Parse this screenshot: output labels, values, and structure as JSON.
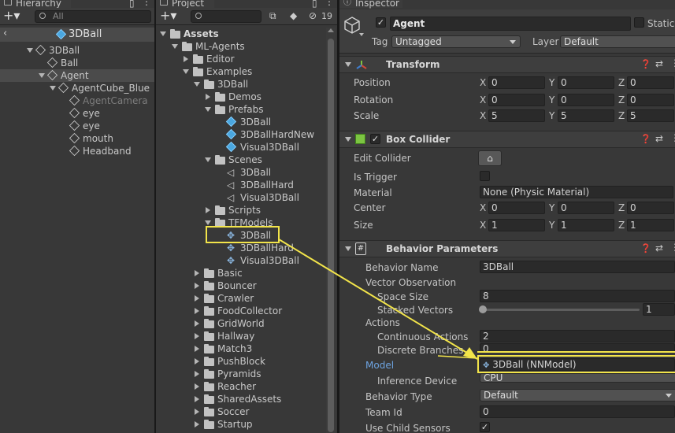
{
  "hierarchy": {
    "tab_title": "Hierarchy",
    "search_placeholder": "All",
    "scene_name": "3DBall",
    "items": [
      {
        "label": "3DBall",
        "depth": 0,
        "expanded": true
      },
      {
        "label": "Ball",
        "depth": 1
      },
      {
        "label": "Agent",
        "depth": 1,
        "expanded": true,
        "selected": true
      },
      {
        "label": "AgentCube_Blue",
        "depth": 2,
        "expanded": true
      },
      {
        "label": "AgentCamera",
        "depth": 3,
        "dimmed": true
      },
      {
        "label": "eye",
        "depth": 3
      },
      {
        "label": "eye",
        "depth": 3
      },
      {
        "label": "mouth",
        "depth": 3
      },
      {
        "label": "Headband",
        "depth": 3
      }
    ]
  },
  "project": {
    "tab_title": "Project",
    "hidden_count": "19",
    "tree": [
      {
        "label": "Assets",
        "depth": 0,
        "state": "open",
        "bold": true
      },
      {
        "label": "ML-Agents",
        "depth": 1,
        "state": "open"
      },
      {
        "label": "Editor",
        "depth": 2,
        "state": "closed"
      },
      {
        "label": "Examples",
        "depth": 2,
        "state": "open"
      },
      {
        "label": "3DBall",
        "depth": 3,
        "state": "open"
      },
      {
        "label": "Demos",
        "depth": 4,
        "state": "closed"
      },
      {
        "label": "Prefabs",
        "depth": 4,
        "state": "open"
      },
      {
        "label": "3DBall",
        "depth": 5,
        "kind": "prefab"
      },
      {
        "label": "3DBallHardNew",
        "depth": 5,
        "kind": "prefab"
      },
      {
        "label": "Visual3DBall",
        "depth": 5,
        "kind": "prefab"
      },
      {
        "label": "Scenes",
        "depth": 4,
        "state": "open"
      },
      {
        "label": "3DBall",
        "depth": 5,
        "kind": "scene"
      },
      {
        "label": "3DBallHard",
        "depth": 5,
        "kind": "scene"
      },
      {
        "label": "Visual3DBall",
        "depth": 5,
        "kind": "scene"
      },
      {
        "label": "Scripts",
        "depth": 4,
        "state": "closed"
      },
      {
        "label": "TFModels",
        "depth": 4,
        "state": "open"
      },
      {
        "label": "3DBall",
        "depth": 5,
        "kind": "nn",
        "highlighted": true
      },
      {
        "label": "3DBallHard",
        "depth": 5,
        "kind": "nn"
      },
      {
        "label": "Visual3DBall",
        "depth": 5,
        "kind": "nn"
      },
      {
        "label": "Basic",
        "depth": 3,
        "state": "closed"
      },
      {
        "label": "Bouncer",
        "depth": 3,
        "state": "closed"
      },
      {
        "label": "Crawler",
        "depth": 3,
        "state": "closed"
      },
      {
        "label": "FoodCollector",
        "depth": 3,
        "state": "closed"
      },
      {
        "label": "GridWorld",
        "depth": 3,
        "state": "closed"
      },
      {
        "label": "Hallway",
        "depth": 3,
        "state": "closed"
      },
      {
        "label": "Match3",
        "depth": 3,
        "state": "closed"
      },
      {
        "label": "PushBlock",
        "depth": 3,
        "state": "closed"
      },
      {
        "label": "Pyramids",
        "depth": 3,
        "state": "closed"
      },
      {
        "label": "Reacher",
        "depth": 3,
        "state": "closed"
      },
      {
        "label": "SharedAssets",
        "depth": 3,
        "state": "closed"
      },
      {
        "label": "Soccer",
        "depth": 3,
        "state": "closed"
      },
      {
        "label": "Startup",
        "depth": 3,
        "state": "closed"
      }
    ]
  },
  "inspector": {
    "tab_title": "Inspector",
    "object_name": "Agent",
    "static_label": "Static",
    "tag_label": "Tag",
    "tag_value": "Untagged",
    "layer_label": "Layer",
    "layer_value": "Default",
    "transform": {
      "title": "Transform",
      "position": {
        "label": "Position",
        "x": "0",
        "y": "0",
        "z": "0"
      },
      "rotation": {
        "label": "Rotation",
        "x": "0",
        "y": "0",
        "z": "0"
      },
      "scale": {
        "label": "Scale",
        "x": "5",
        "y": "5",
        "z": "5"
      }
    },
    "box_collider": {
      "title": "Box Collider",
      "edit_collider": "Edit Collider",
      "is_trigger": "Is Trigger",
      "material_label": "Material",
      "material_value": "None (Physic Material)",
      "center": {
        "label": "Center",
        "x": "0",
        "y": "0",
        "z": "0"
      },
      "size": {
        "label": "Size",
        "x": "1",
        "y": "1",
        "z": "1"
      }
    },
    "behavior": {
      "title": "Behavior Parameters",
      "behavior_name_label": "Behavior Name",
      "behavior_name_value": "3DBall",
      "vector_obs_label": "Vector Observation",
      "space_size_label": "Space Size",
      "space_size_value": "8",
      "stacked_label": "Stacked Vectors",
      "stacked_value": "1",
      "stacked_level": 0,
      "actions_label": "Actions",
      "continuous_label": "Continuous Actions",
      "continuous_value": "2",
      "discrete_label": "Discrete Branches",
      "discrete_value": "0",
      "model_label": "Model",
      "model_value": "3DBall (NNModel)",
      "inference_label": "Inference Device",
      "inference_value": "CPU",
      "behavior_type_label": "Behavior Type",
      "behavior_type_value": "Default",
      "team_id_label": "Team Id",
      "team_id_value": "0",
      "child_sensors_label": "Use Child Sensors"
    },
    "axis": {
      "x": "X",
      "y": "Y",
      "z": "Z"
    }
  },
  "colors": {
    "annotation": "#f2e44a",
    "link_label": "#6da3e0",
    "selection": "#4b4b4b"
  }
}
